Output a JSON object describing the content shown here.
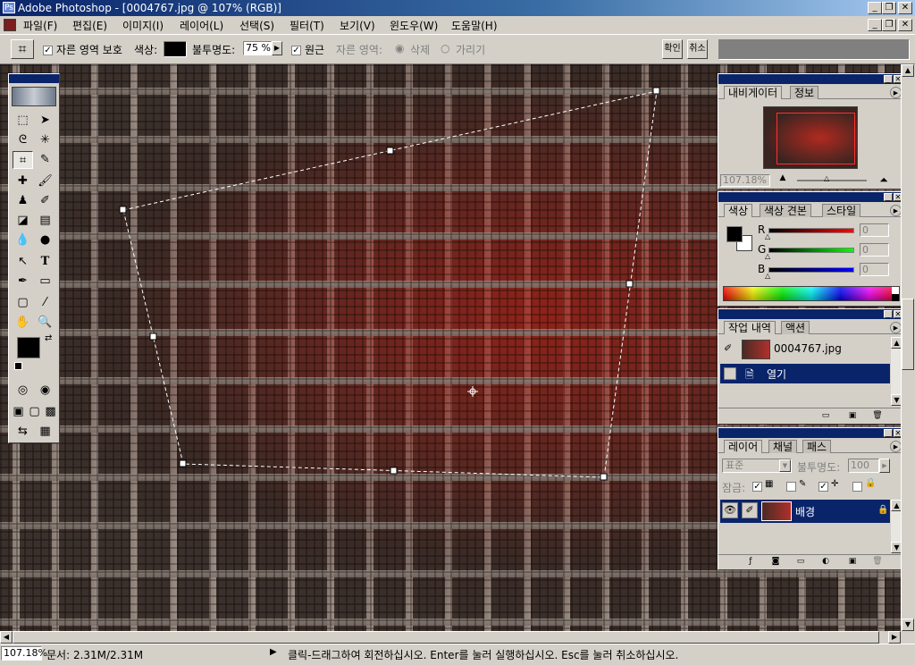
{
  "app": {
    "title": "Adobe Photoshop - [0004767.jpg @ 107% (RGB)]",
    "window_buttons": [
      "_",
      "❐",
      "✕"
    ]
  },
  "menu": [
    "파일(F)",
    "편집(E)",
    "이미지(I)",
    "레이어(L)",
    "선택(S)",
    "필터(T)",
    "보기(V)",
    "윈도우(W)",
    "도움말(H)"
  ],
  "options": {
    "protect_label": "자른 영역 보호",
    "color_label": "색상:",
    "color_value": "#000000",
    "opacity_label": "불투명도:",
    "opacity_value": "75 %",
    "perspective_label": "원근",
    "crop_area_label": "자른 영역:",
    "delete_label": "삭제",
    "hide_label": "가리기",
    "ok_label": "확인",
    "cancel_label": "취소"
  },
  "toolbox": {
    "tools": [
      "rect-marquee",
      "move",
      "lasso",
      "magic-wand",
      "crop",
      "slice",
      "healing",
      "brush",
      "stamp",
      "history-brush",
      "eraser",
      "gradient",
      "blur",
      "dodge",
      "path-select",
      "type",
      "pen",
      "shape",
      "notes",
      "eyedropper",
      "hand",
      "zoom"
    ],
    "text_tool_glyph": "T",
    "foreground": "#000000",
    "background": "#ffffff"
  },
  "navigator": {
    "tabs": [
      "내비게이터",
      "정보"
    ],
    "zoom": "107.18%"
  },
  "color_palette": {
    "tabs": [
      "색상",
      "색상 견본",
      "스타일"
    ],
    "channels": [
      {
        "label": "R",
        "value": "0",
        "color": "#d00000"
      },
      {
        "label": "G",
        "value": "0",
        "color": "#00b000"
      },
      {
        "label": "B",
        "value": "0",
        "color": "#0000d0"
      }
    ]
  },
  "history": {
    "tabs": [
      "작업 내역",
      "액션"
    ],
    "snapshot": "0004767.jpg",
    "state": "열기"
  },
  "layers": {
    "tabs": [
      "레이어",
      "채널",
      "패스"
    ],
    "mode": "표준",
    "opacity_label": "불투명도:",
    "opacity_value": "100",
    "lock_label": "잠금:",
    "layer_name": "배경"
  },
  "status": {
    "zoom": "107.18%",
    "doc_info": "문서: 2.31M/2.31M",
    "hint": "클릭-드래그하여 회전하십시오. Enter를 눌러 실행하십시오. Esc를 눌러 취소하십시오."
  }
}
